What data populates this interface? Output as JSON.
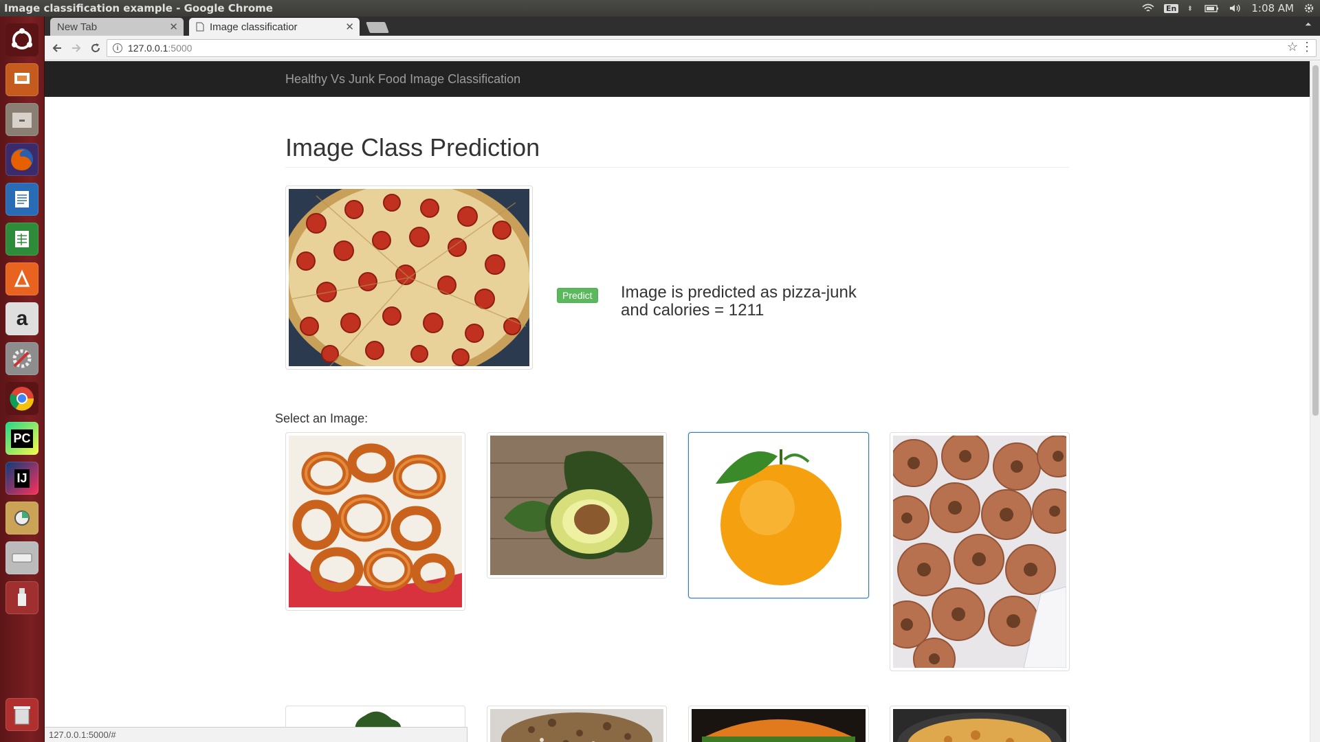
{
  "os": {
    "window_title": "Image classification example - Google Chrome",
    "keyboard_layout": "En",
    "clock": "1:08 AM"
  },
  "launcher": {
    "items": [
      {
        "name": "ubuntu-dash-icon",
        "color": "#dd4814"
      },
      {
        "name": "impress-icon",
        "color": "#c65b1e"
      },
      {
        "name": "files-icon",
        "color": "#8a7f73"
      },
      {
        "name": "firefox-icon",
        "color": "#e66000"
      },
      {
        "name": "writer-icon",
        "color": "#2a6bb6"
      },
      {
        "name": "calc-icon",
        "color": "#2e8b3a"
      },
      {
        "name": "software-center-icon",
        "color": "#e8631f"
      },
      {
        "name": "amazon-icon",
        "color": "#dedede"
      },
      {
        "name": "system-settings-icon",
        "color": "#b43a3a"
      },
      {
        "name": "chrome-icon",
        "color": "#4285f4"
      },
      {
        "name": "pycharm-icon",
        "color": "#21d789"
      },
      {
        "name": "intellij-icon",
        "color": "#0b3b7a"
      },
      {
        "name": "disk-usage-icon",
        "color": "#caa357"
      },
      {
        "name": "drive-icon",
        "color": "#bbbbbb"
      },
      {
        "name": "usb-icon",
        "color": "#cc3333"
      },
      {
        "name": "trash-icon",
        "color": "#cccccc"
      }
    ],
    "labels": {
      "pycharm": "PC",
      "intellij": "IJ",
      "amazon": "a"
    }
  },
  "browser": {
    "tabs": [
      {
        "label": "New Tab"
      },
      {
        "label": "Image classificatior"
      }
    ],
    "url_host": "127.0.0.1",
    "url_port": ":5000",
    "status_url": "127.0.0.1:5000/#"
  },
  "app": {
    "brand": "Healthy Vs Junk Food Image Classification",
    "page_title": "Image Class Prediction",
    "predict_label": "Predict",
    "result_line1": "Image is predicted as pizza-junk",
    "result_line2": "and calories = 1211",
    "select_label": "Select an Image:",
    "gallery": [
      {
        "name": "onion-rings",
        "selected": false
      },
      {
        "name": "avocado",
        "selected": false
      },
      {
        "name": "orange",
        "selected": true
      },
      {
        "name": "donuts",
        "selected": false
      },
      {
        "name": "greens",
        "selected": false
      },
      {
        "name": "granola",
        "selected": false
      },
      {
        "name": "burger",
        "selected": false
      },
      {
        "name": "casserole",
        "selected": false
      }
    ]
  },
  "colors": {
    "navbar_bg": "#222222",
    "predict_button": "#5cb85c",
    "selected_border": "#337ab7"
  }
}
